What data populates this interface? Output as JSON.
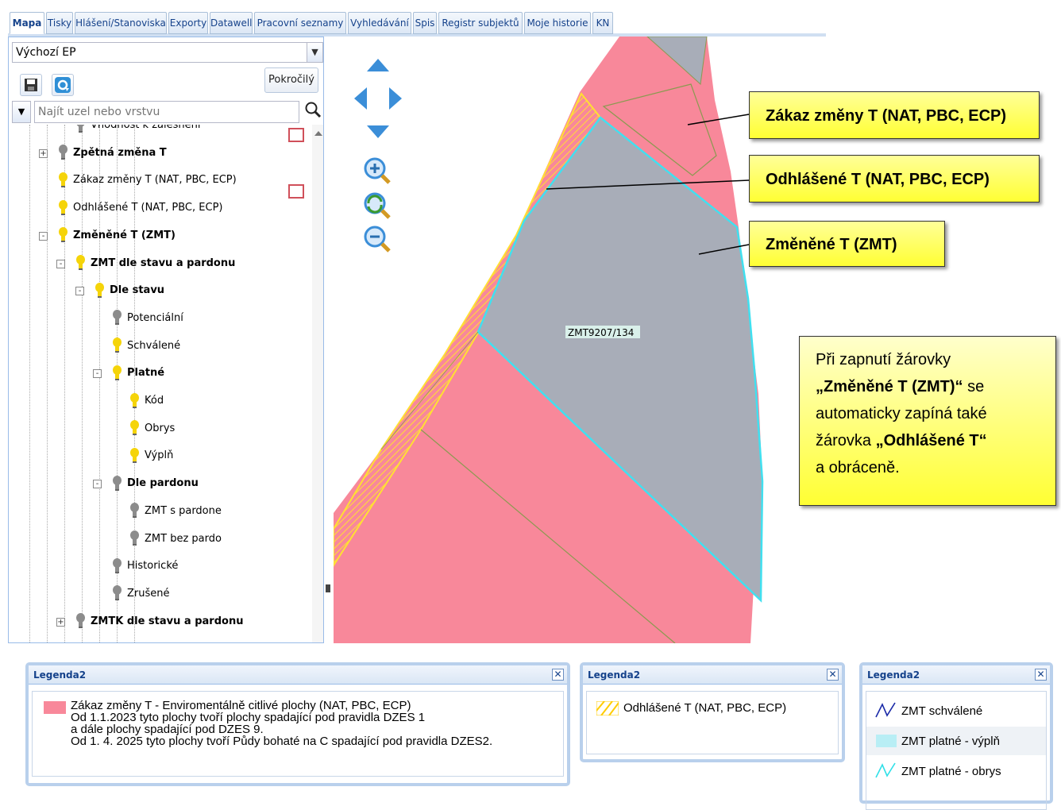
{
  "tabs": [
    "Mapa",
    "Tisky",
    "Hlášení/Stanoviska",
    "Exporty",
    "Datawell",
    "Pracovní seznamy",
    "Vyhledávání",
    "Spis",
    "Registr subjektů",
    "Moje historie",
    "KN"
  ],
  "left": {
    "combo_value": "Výchozí EP",
    "advanced_label": "Pokročilý",
    "search_placeholder": "Najít uzel nebo vrstvu",
    "tree": [
      {
        "label": "Vhodnost k zalesnění",
        "bold": false,
        "bulb": "grey"
      },
      {
        "label": "Zpětná změna T",
        "bold": true,
        "bulb": "grey"
      },
      {
        "label": "Zákaz změny T (NAT, PBC, ECP)",
        "bold": false,
        "bulb": "yellow"
      },
      {
        "label": "Odhlášené T (NAT, PBC, ECP)",
        "bold": false,
        "bulb": "yellow"
      },
      {
        "label": "Změněné T (ZMT)",
        "bold": true,
        "bulb": "yellow"
      },
      {
        "label": "ZMT dle stavu a pardonu",
        "bold": true,
        "bulb": "yellow"
      },
      {
        "label": "Dle stavu",
        "bold": true,
        "bulb": "yellow"
      },
      {
        "label": "Potenciální",
        "bold": false,
        "bulb": "grey"
      },
      {
        "label": "Schválené",
        "bold": false,
        "bulb": "yellow"
      },
      {
        "label": "Platné",
        "bold": true,
        "bulb": "yellow"
      },
      {
        "label": "Kód",
        "bold": false,
        "bulb": "yellow"
      },
      {
        "label": "Obrys",
        "bold": false,
        "bulb": "yellow"
      },
      {
        "label": "Výplň",
        "bold": false,
        "bulb": "yellow"
      },
      {
        "label": "Dle pardonu",
        "bold": true,
        "bulb": "grey"
      },
      {
        "label": "ZMT s pardone",
        "bold": false,
        "bulb": "grey"
      },
      {
        "label": "ZMT bez pardo",
        "bold": false,
        "bulb": "grey"
      },
      {
        "label": "Historické",
        "bold": false,
        "bulb": "grey"
      },
      {
        "label": "Zrušené",
        "bold": false,
        "bulb": "grey"
      },
      {
        "label": "ZMTK dle stavu a pardonu",
        "bold": true,
        "bulb": "grey"
      }
    ]
  },
  "map": {
    "parcel_label": "ZMT9207/134",
    "callouts": [
      "Zákaz změny T (NAT, PBC, ECP)",
      "Odhlášené T (NAT, PBC, ECP)",
      "Změněné T (ZMT)"
    ],
    "note": {
      "l1": "Při zapnutí žárovky",
      "l2_bold": "„Změněné T (ZMT)“",
      "l2_rest": " se",
      "l3": "automaticky zapíná také",
      "l4_pre": "žárovka ",
      "l4_bold": "„Odhlášené T“",
      "l5": "a obráceně."
    },
    "colors": {
      "pink": "#f8889a",
      "grey": "#a8adb8",
      "cyan": "#40e0f0",
      "yellow": "#ffee33"
    }
  },
  "legends": [
    {
      "title": "Legenda2",
      "lines": [
        "Zákaz změny T - Enviromentálně citlivé plochy (NAT, PBC, ECP)",
        "Od 1.1.2023 tyto plochy tvoří plochy spadající pod pravidla DZES 1",
        "a dále plochy spadající pod DZES 9.",
        "Od 1. 4. 2025 tyto plochy tvoří Půdy bohaté na C spadající pod pravidla DZES2."
      ]
    },
    {
      "title": "Legenda2",
      "lines": [
        "Odhlášené T (NAT, PBC, ECP)"
      ]
    },
    {
      "title": "Legenda2",
      "lines": [
        "ZMT schválené",
        "ZMT platné - výplň",
        "ZMT platné - obrys"
      ]
    }
  ]
}
